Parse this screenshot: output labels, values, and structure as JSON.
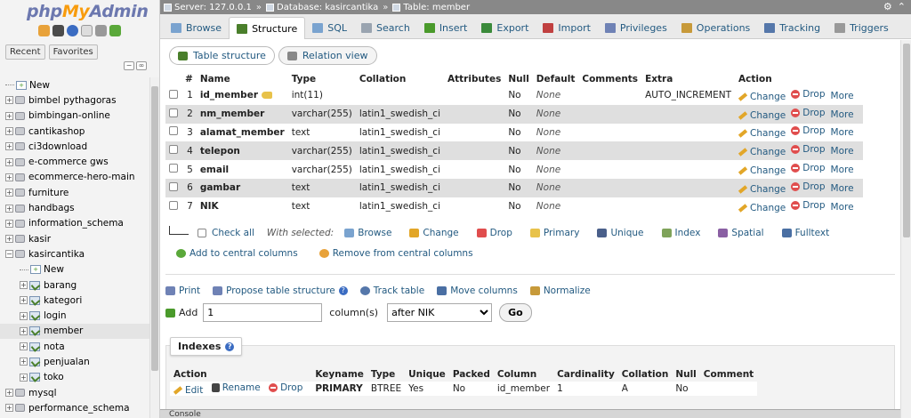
{
  "nav": {
    "logo_php": "php",
    "logo_my": "My",
    "logo_admin": "Admin",
    "tabs": [
      "Recent",
      "Favorites"
    ],
    "tree": [
      {
        "label": "New",
        "type": "new"
      },
      {
        "label": "bimbel pythagoras",
        "type": "db"
      },
      {
        "label": "bimbingan-online",
        "type": "db"
      },
      {
        "label": "cantikashop",
        "type": "db"
      },
      {
        "label": "ci3download",
        "type": "db"
      },
      {
        "label": "e-commerce gws",
        "type": "db"
      },
      {
        "label": "ecommerce-hero-main",
        "type": "db"
      },
      {
        "label": "furniture",
        "type": "db"
      },
      {
        "label": "handbags",
        "type": "db"
      },
      {
        "label": "information_schema",
        "type": "db"
      },
      {
        "label": "kasir",
        "type": "db"
      },
      {
        "label": "kasircantika",
        "type": "db-open"
      },
      {
        "label": "New",
        "type": "child-new"
      },
      {
        "label": "barang",
        "type": "table"
      },
      {
        "label": "kategori",
        "type": "table"
      },
      {
        "label": "login",
        "type": "table"
      },
      {
        "label": "member",
        "type": "table-selected"
      },
      {
        "label": "nota",
        "type": "table"
      },
      {
        "label": "penjualan",
        "type": "table"
      },
      {
        "label": "toko",
        "type": "table"
      },
      {
        "label": "mysql",
        "type": "db"
      },
      {
        "label": "performance_schema",
        "type": "db"
      }
    ]
  },
  "breadcrumb": {
    "server": "Server: 127.0.0.1",
    "database": "Database: kasircantika",
    "table": "Table: member",
    "sep": "»"
  },
  "tabs": [
    {
      "label": "Browse",
      "color": "#7aa3cf"
    },
    {
      "label": "Structure",
      "color": "#4a7f2b",
      "active": true
    },
    {
      "label": "SQL",
      "color": "#7aa3cf"
    },
    {
      "label": "Search",
      "color": "#9aa4b0"
    },
    {
      "label": "Insert",
      "color": "#4a9a2b"
    },
    {
      "label": "Export",
      "color": "#3a8a3a"
    },
    {
      "label": "Import",
      "color": "#c04040"
    },
    {
      "label": "Privileges",
      "color": "#6f82b5"
    },
    {
      "label": "Operations",
      "color": "#c79a3a"
    },
    {
      "label": "Tracking",
      "color": "#5577aa"
    },
    {
      "label": "Triggers",
      "color": "#999999"
    }
  ],
  "subtabs": {
    "structure": "Table structure",
    "relation": "Relation view"
  },
  "structure": {
    "headers": {
      "num": "#",
      "name": "Name",
      "type": "Type",
      "collation": "Collation",
      "attributes": "Attributes",
      "null": "Null",
      "default": "Default",
      "comments": "Comments",
      "extra": "Extra",
      "action": "Action"
    },
    "actions": {
      "change": "Change",
      "drop": "Drop",
      "more": "More"
    },
    "rows": [
      {
        "num": "1",
        "name": "id_member",
        "type": "int(11)",
        "collation": "",
        "null": "No",
        "default": "None",
        "extra": "AUTO_INCREMENT",
        "primary": true
      },
      {
        "num": "2",
        "name": "nm_member",
        "type": "varchar(255)",
        "collation": "latin1_swedish_ci",
        "null": "No",
        "default": "None",
        "extra": ""
      },
      {
        "num": "3",
        "name": "alamat_member",
        "type": "text",
        "collation": "latin1_swedish_ci",
        "null": "No",
        "default": "None",
        "extra": ""
      },
      {
        "num": "4",
        "name": "telepon",
        "type": "varchar(255)",
        "collation": "latin1_swedish_ci",
        "null": "No",
        "default": "None",
        "extra": ""
      },
      {
        "num": "5",
        "name": "email",
        "type": "varchar(255)",
        "collation": "latin1_swedish_ci",
        "null": "No",
        "default": "None",
        "extra": ""
      },
      {
        "num": "6",
        "name": "gambar",
        "type": "text",
        "collation": "latin1_swedish_ci",
        "null": "No",
        "default": "None",
        "extra": ""
      },
      {
        "num": "7",
        "name": "NIK",
        "type": "text",
        "collation": "latin1_swedish_ci",
        "null": "No",
        "default": "None",
        "extra": ""
      }
    ]
  },
  "with_selected": {
    "check_all": "Check all",
    "label": "With selected:",
    "items": [
      {
        "label": "Browse",
        "color": "#7aa3cf"
      },
      {
        "label": "Change",
        "color": "#e2a628"
      },
      {
        "label": "Drop",
        "color": "#e04d4d"
      },
      {
        "label": "Primary",
        "color": "#e8c24a"
      },
      {
        "label": "Unique",
        "color": "#4a5f8a"
      },
      {
        "label": "Index",
        "color": "#7fa35a"
      },
      {
        "label": "Spatial",
        "color": "#8a5fa3"
      },
      {
        "label": "Fulltext",
        "color": "#4a6fa3"
      }
    ]
  },
  "central": {
    "add": "Add to central columns",
    "remove": "Remove from central columns"
  },
  "links": {
    "print": "Print",
    "propose": "Propose table structure",
    "track": "Track table",
    "move": "Move columns",
    "normalize": "Normalize"
  },
  "add_column": {
    "label": "Add",
    "value": "1",
    "unit": "column(s)",
    "position": "after NIK",
    "go": "Go"
  },
  "indexes": {
    "title": "Indexes",
    "headers": [
      "Action",
      "Keyname",
      "Type",
      "Unique",
      "Packed",
      "Column",
      "Cardinality",
      "Collation",
      "Null",
      "Comment"
    ],
    "actions": {
      "edit": "Edit",
      "rename": "Rename",
      "drop": "Drop"
    },
    "row": {
      "keyname": "PRIMARY",
      "type": "BTREE",
      "unique": "Yes",
      "packed": "No",
      "column": "id_member",
      "cardinality": "1",
      "collation": "A",
      "null": "No",
      "comment": ""
    }
  },
  "console": "Console"
}
